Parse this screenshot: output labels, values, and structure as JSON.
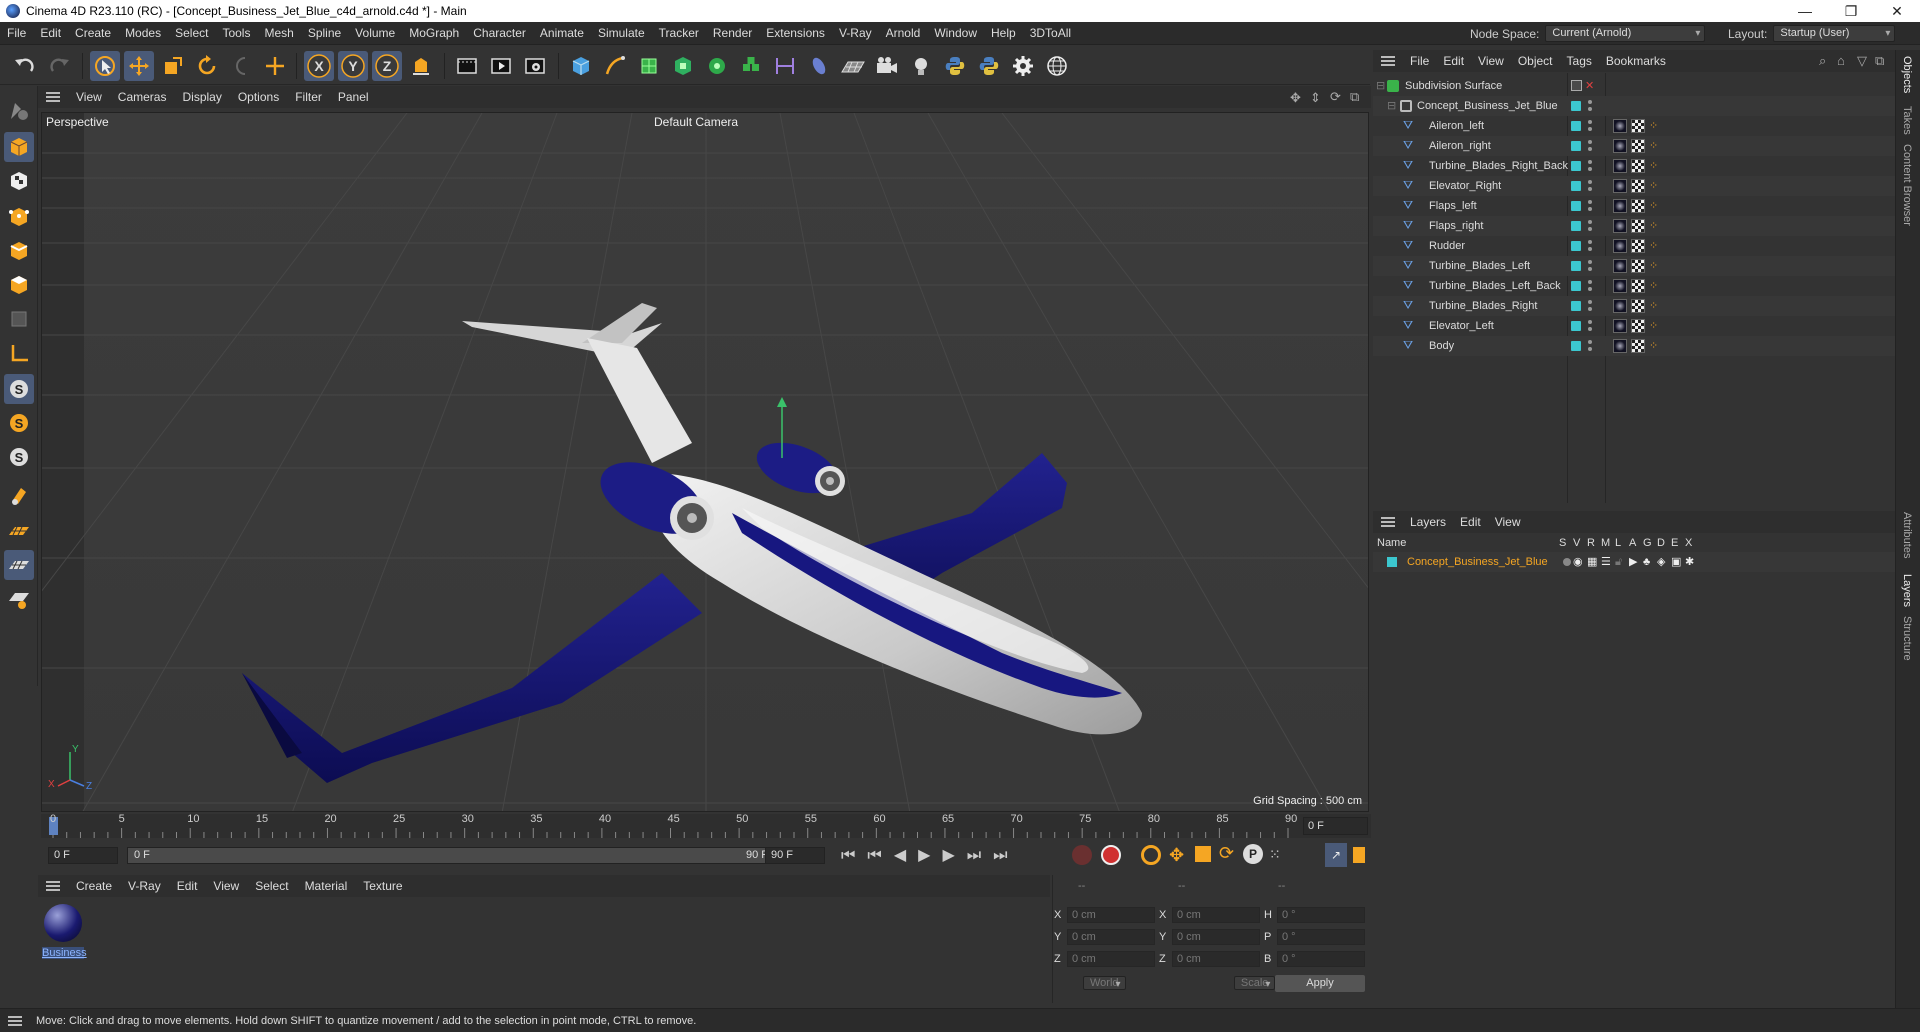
{
  "window": {
    "title": "Cinema 4D R23.110 (RC) - [Concept_Business_Jet_Blue_c4d_arnold.c4d *] - Main",
    "minimize": "—",
    "maximize": "❐",
    "close": "✕"
  },
  "menubar": {
    "items": [
      "File",
      "Edit",
      "Create",
      "Modes",
      "Select",
      "Tools",
      "Mesh",
      "Spline",
      "Volume",
      "MoGraph",
      "Character",
      "Animate",
      "Simulate",
      "Tracker",
      "Render",
      "Extensions",
      "V-Ray",
      "Arnold",
      "Window",
      "Help",
      "3DToAll"
    ],
    "node_space_label": "Node Space:",
    "node_space_value": "Current (Arnold)",
    "layout_label": "Layout:",
    "layout_value": "Startup (User)"
  },
  "viewport": {
    "menu": [
      "View",
      "Cameras",
      "Display",
      "Options",
      "Filter",
      "Panel"
    ],
    "label": "Perspective",
    "camera": "Default Camera",
    "grid_spacing": "Grid Spacing : 500 cm",
    "axis_x": "X",
    "axis_y": "Y",
    "axis_z": "Z"
  },
  "timeline": {
    "ticks": [
      "0",
      "5",
      "10",
      "15",
      "20",
      "25",
      "30",
      "35",
      "40",
      "45",
      "50",
      "55",
      "60",
      "65",
      "70",
      "75",
      "80",
      "85",
      "90"
    ],
    "current_frame": "0 F",
    "start_field": "0 F",
    "range_start": "0 F",
    "range_end": "90 F",
    "end_field": "90 F"
  },
  "material_manager": {
    "menu": [
      "Create",
      "V-Ray",
      "Edit",
      "View",
      "Select",
      "Material",
      "Texture"
    ],
    "materials": [
      {
        "name": "Business"
      }
    ]
  },
  "coordinates": {
    "header": [
      "--",
      "--",
      "--"
    ],
    "rows": [
      {
        "a": "X",
        "a_val": "0 cm",
        "b": "X",
        "b_val": "0 cm",
        "c": "H",
        "c_val": "0 °"
      },
      {
        "a": "Y",
        "a_val": "0 cm",
        "b": "Y",
        "b_val": "0 cm",
        "c": "P",
        "c_val": "0 °"
      },
      {
        "a": "Z",
        "a_val": "0 cm",
        "b": "Z",
        "b_val": "0 cm",
        "c": "B",
        "c_val": "0 °"
      }
    ],
    "space": "World",
    "mode": "Scale",
    "apply": "Apply"
  },
  "object_manager": {
    "menu": [
      "File",
      "Edit",
      "View",
      "Object",
      "Tags",
      "Bookmarks"
    ],
    "root": "Subdivision Surface",
    "group": "Concept_Business_Jet_Blue",
    "objects": [
      "Aileron_left",
      "Aileron_right",
      "Turbine_Blades_Right_Back",
      "Elevator_Right",
      "Flaps_left",
      "Flaps_right",
      "Rudder",
      "Turbine_Blades_Left",
      "Turbine_Blades_Left_Back",
      "Turbine_Blades_Right",
      "Elevator_Left",
      "Body"
    ]
  },
  "layer_manager": {
    "menu": [
      "Layers",
      "Edit",
      "View"
    ],
    "columns": [
      "Name",
      "S",
      "V",
      "R",
      "M",
      "L",
      "A",
      "G",
      "D",
      "E",
      "X"
    ],
    "layers": [
      {
        "name": "Concept_Business_Jet_Blue",
        "color": "#3cc7cf"
      }
    ]
  },
  "side_tabs": [
    "Objects",
    "Takes",
    "Content Browser",
    "Attributes",
    "Layers",
    "Structure"
  ],
  "status": "Move: Click and drag to move elements. Hold down SHIFT to quantize movement / add to the selection in point mode, CTRL to remove.",
  "colors": {
    "accent_selected": "#4a5a78",
    "layer_color": "#3cc7cf",
    "jet_blue": "#1a1a7a",
    "jet_white": "#d8d8d8"
  }
}
